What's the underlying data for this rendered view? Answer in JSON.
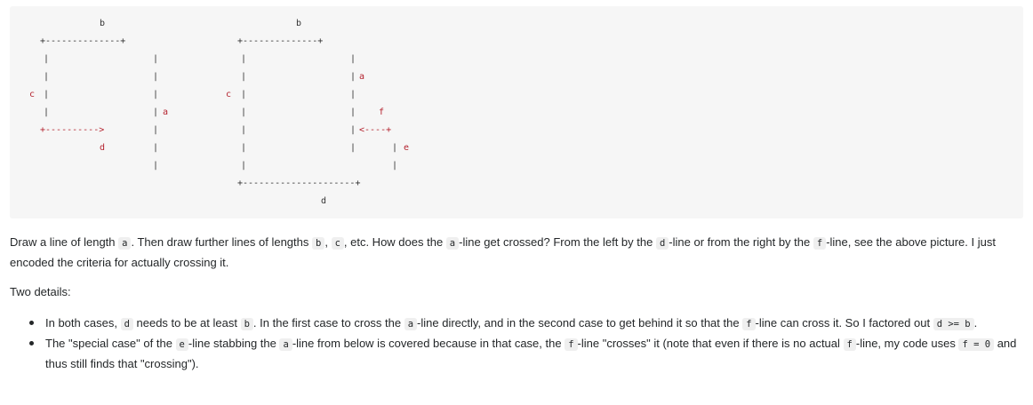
{
  "code_block": {
    "lines": [
      "         b                     b",
      "",
      " +--------------+       +--------------+",
      " |              |       |              |",
      " |              |       |              | a",
      "c |              |     c |              |",
      " |              | a     |              |   f",
      " +---------->   |       |              | <----+",
      "          d     |       |              |      | e",
      "                |       |              |      |",
      "                        +---------------------+",
      "                                   d"
    ]
  },
  "paragraph1": {
    "t1": "Draw a line of length ",
    "c1": "a",
    "t2": ". Then draw further lines of lengths ",
    "c2": "b",
    "t3": ", ",
    "c3": "c",
    "t4": ", etc. How does the ",
    "c4": "a",
    "t5": "-line get crossed? From the left by the ",
    "c5": "d",
    "t6": "-line or from the right by the ",
    "c6": "f",
    "t7": "-line, see the above picture. I just encoded the criteria for actually crossing it."
  },
  "paragraph2": {
    "text": "Two details:"
  },
  "bullet1": {
    "t1": "In both cases, ",
    "c1": "d",
    "t2": " needs to be at least ",
    "c2": "b",
    "t3": ". In the first case to cross the ",
    "c3": "a",
    "t4": "-line directly, and in the second case to get behind it so that the ",
    "c4": "f",
    "t5": "-line can cross it. So I factored out ",
    "c5": "d >= b",
    "t6": "."
  },
  "bullet2": {
    "t1": "The \"special case\" of the ",
    "c1": "e",
    "t2": "-line stabbing the ",
    "c2": "a",
    "t3": "-line from below is covered because in that case, the ",
    "c3": "f",
    "t4": "-line \"crosses\" it (note that even if there is no actual ",
    "c4": "f",
    "t5": "-line, my code uses ",
    "c5": "f = 0",
    "t6": " and thus still finds that \"crossing\")."
  }
}
